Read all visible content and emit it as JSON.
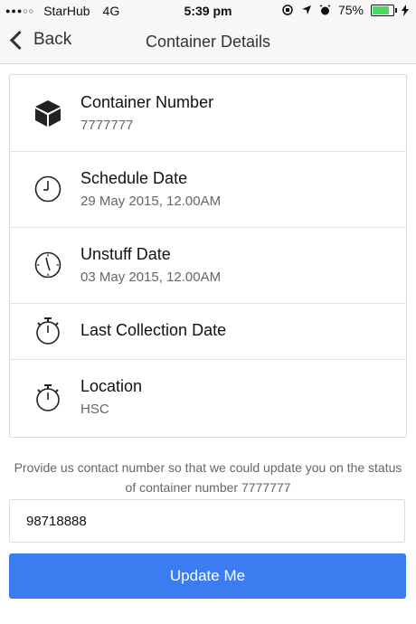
{
  "status_bar": {
    "signal": "●●●○○",
    "carrier": "StarHub",
    "network": "4G",
    "time": "5:39 pm",
    "battery_percent": "75%",
    "battery_level": 0.75
  },
  "nav": {
    "back_label": "Back",
    "title": "Container Details"
  },
  "details": [
    {
      "icon": "box-icon",
      "title": "Container Number",
      "value": "7777777"
    },
    {
      "icon": "clock-icon",
      "title": "Schedule Date",
      "value": "29 May 2015, 12.00AM"
    },
    {
      "icon": "clock-icon",
      "title": "Unstuff Date",
      "value": "03 May 2015, 12.00AM"
    },
    {
      "icon": "stopwatch-icon",
      "title": "Last Collection Date",
      "value": ""
    },
    {
      "icon": "stopwatch-icon",
      "title": "Location",
      "value": "HSC"
    }
  ],
  "form": {
    "prompt": "Provide us contact number so that we could update you on the status of container number 7777777",
    "phone_value": "98718888",
    "submit_label": "Update Me"
  },
  "colors": {
    "accent": "#3b7cf0",
    "battery": "#4cd964"
  }
}
